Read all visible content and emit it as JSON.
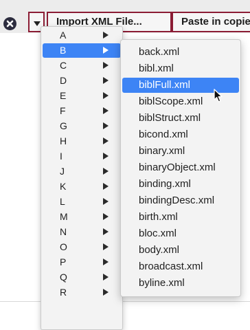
{
  "toolbar": {
    "dropdown_icon": "chevron-down-icon",
    "close_icon": "close-circle-icon",
    "import_label": "Import XML File...",
    "paste_label": "Paste in copied XML",
    "accent_color": "#8b1c34"
  },
  "letter_menu": {
    "selected": "B",
    "items": [
      {
        "label": "A"
      },
      {
        "label": "B"
      },
      {
        "label": "C"
      },
      {
        "label": "D"
      },
      {
        "label": "E"
      },
      {
        "label": "F"
      },
      {
        "label": "G"
      },
      {
        "label": "H"
      },
      {
        "label": "I"
      },
      {
        "label": "J"
      },
      {
        "label": "K"
      },
      {
        "label": "L"
      },
      {
        "label": "M"
      },
      {
        "label": "N"
      },
      {
        "label": "O"
      },
      {
        "label": "P"
      },
      {
        "label": "Q"
      },
      {
        "label": "R"
      }
    ]
  },
  "file_menu": {
    "highlighted": "biblFull.xml",
    "highlight_color": "#3d84f5",
    "items": [
      {
        "label": "back.xml"
      },
      {
        "label": "bibl.xml"
      },
      {
        "label": "biblFull.xml"
      },
      {
        "label": "biblScope.xml"
      },
      {
        "label": "biblStruct.xml"
      },
      {
        "label": "bicond.xml"
      },
      {
        "label": "binary.xml"
      },
      {
        "label": "binaryObject.xml"
      },
      {
        "label": "binding.xml"
      },
      {
        "label": "bindingDesc.xml"
      },
      {
        "label": "birth.xml"
      },
      {
        "label": "bloc.xml"
      },
      {
        "label": "body.xml"
      },
      {
        "label": "broadcast.xml"
      },
      {
        "label": "byline.xml"
      }
    ]
  },
  "pointer": {
    "icon": "mouse-pointer-icon"
  }
}
